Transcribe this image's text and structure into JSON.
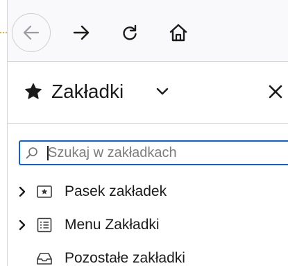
{
  "toolbar": {
    "buttons": [
      {
        "name": "back",
        "icon": "arrow-left-icon"
      },
      {
        "name": "forward",
        "icon": "arrow-right-icon"
      },
      {
        "name": "reload",
        "icon": "reload-icon"
      },
      {
        "name": "home",
        "icon": "home-icon"
      }
    ]
  },
  "sidebar": {
    "title": "Zakładki",
    "title_icon": "star-icon",
    "switcher_icon": "chevron-down-icon",
    "close_icon": "close-icon",
    "search": {
      "placeholder": "Szukaj w zakładkach",
      "value": "",
      "icon": "search-icon"
    },
    "items": [
      {
        "label": "Pasek zakładek",
        "icon": "bookmarks-toolbar-icon",
        "expandable": true
      },
      {
        "label": "Menu Zakładki",
        "icon": "bookmarks-menu-icon",
        "expandable": true
      },
      {
        "label": "Pozostałe zakładki",
        "icon": "other-bookmarks-icon",
        "expandable": false
      }
    ]
  },
  "colors": {
    "focus_ring": "#0a63d8",
    "toolbar_bg": "#f9f9fb",
    "text": "#1b1b1b",
    "placeholder": "#7d7d80"
  }
}
